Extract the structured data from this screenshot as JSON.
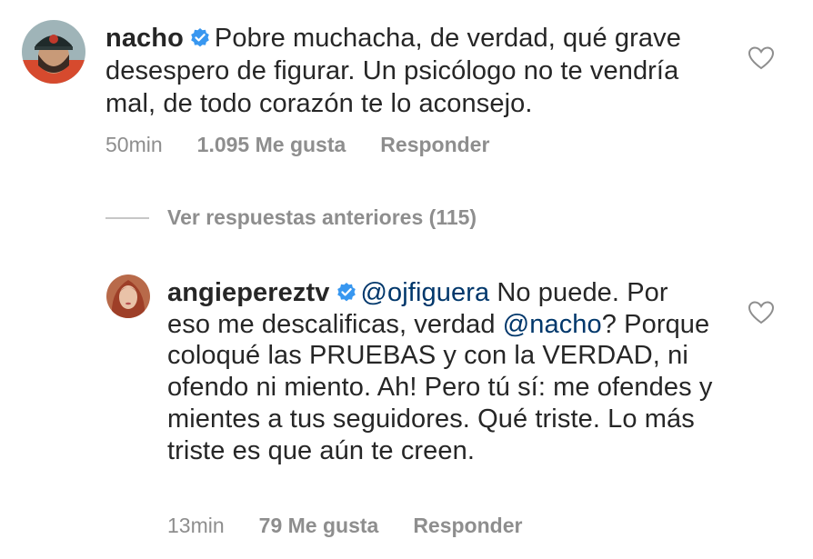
{
  "comments": [
    {
      "username": "nacho",
      "verified_icon": "verified-badge-icon",
      "text": "Pobre muchacha, de verdad, qué grave desespero de figurar. Un psicólogo no te vendría mal, de todo corazón te lo aconsejo.",
      "time": "50min",
      "likes": "1.095 Me gusta",
      "reply_label": "Responder"
    },
    {
      "username": "angieperez­tv",
      "verified_icon": "verified-badge-icon",
      "mention_start": "@ojfiguera",
      "text_part1": " No puede. Por eso me descalificas, verdad ",
      "mention_mid": "@nacho",
      "text_part2": "? Porque coloqué las PRUEBAS y con la VERDAD, ni ofendo ni miento. Ah! Pero tú sí: me ofendes y mientes a tus seguidores. Qué triste. Lo más triste es que aún te creen.",
      "time": "13min",
      "likes": "79 Me gusta",
      "reply_label": "Responder"
    }
  ],
  "view_previous_replies": "Ver respuestas anteriores (115)",
  "colors": {
    "text": "#262626",
    "meta": "#8e8e8e",
    "mention": "#00376b",
    "verified": "#3897f0"
  }
}
